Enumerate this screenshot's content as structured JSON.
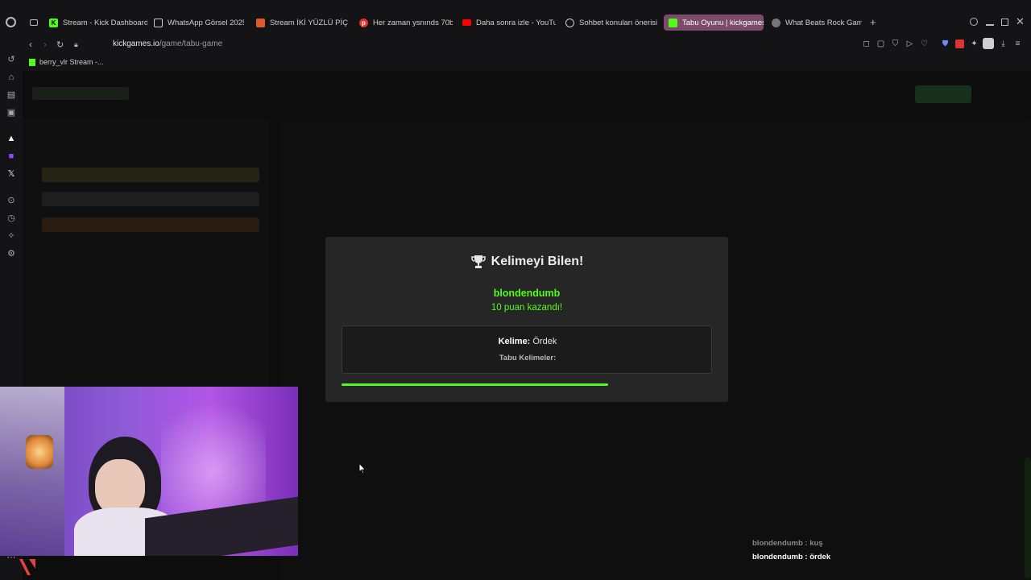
{
  "tabs": [
    {
      "label": "Stream - Kick Dashboard",
      "icon": "kick-icon",
      "color": "#53fc18"
    },
    {
      "label": "WhatsApp Görsel 2025-",
      "icon": "document-icon",
      "color": "#cccccc"
    },
    {
      "label": "Stream İKİ YÜZLÜ PİÇ by",
      "icon": "stream-icon",
      "color": "#e25a2b"
    },
    {
      "label": "Her zaman ysnınds 70bp",
      "icon": "pinterest-icon",
      "color": "#e0302e"
    },
    {
      "label": "Daha sonra izle - YouTub",
      "icon": "youtube-icon",
      "color": "#ff0000"
    },
    {
      "label": "Sohbet konuları önerisi",
      "icon": "chatgpt-icon",
      "color": "#cccccc"
    },
    {
      "label": "Tabu Oyunu | kickgames",
      "icon": "kickgames-icon",
      "color": "#53fc18"
    },
    {
      "label": "What Beats Rock Game",
      "icon": "rock-icon",
      "color": "#999999"
    }
  ],
  "address": {
    "domain": "kickgames.io",
    "path": "/game/tabu-game"
  },
  "bookmarks": [
    {
      "label": "berry_vlr Stream -..."
    }
  ],
  "modal": {
    "title": "Kelimeyi Bilen!",
    "winner": "blondendumb",
    "points": "10 puan kazandı!",
    "word_label": "Kelime:",
    "word": "Ördek",
    "taboo_label": "Tabu Kelimeler:",
    "progress_fraction": 0.72
  },
  "chat": [
    {
      "text": "blondendumb : kuş",
      "color": "#8a8a8a"
    },
    {
      "text": "blondendumb : ördek",
      "color": "#ffffff"
    }
  ],
  "colors": {
    "accent": "#53fc18",
    "modal_bg": "#262627",
    "active_tab": "#7c4a6a"
  }
}
